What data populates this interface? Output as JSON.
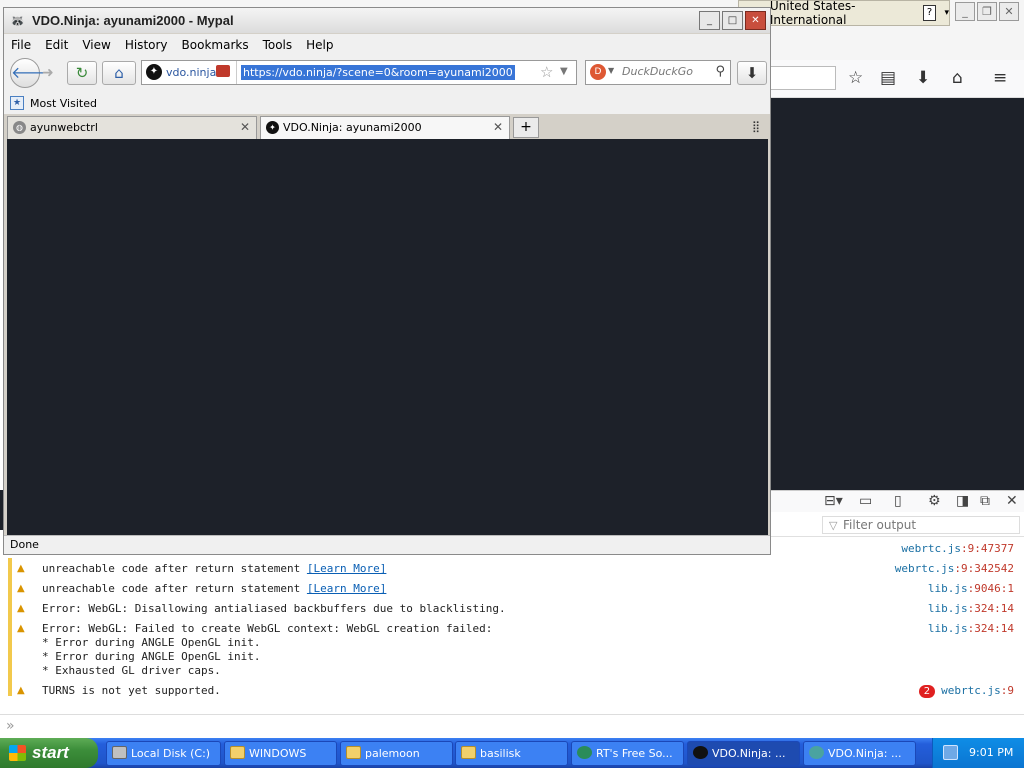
{
  "background_browser": {
    "language_bar": {
      "language": "United States-International",
      "help_label": "?"
    }
  },
  "devtools": {
    "filter_placeholder": "Filter output",
    "messages": [
      {
        "type": "warning",
        "text": "",
        "link": "",
        "source": "webrtc.js",
        "location": ":9:47377"
      },
      {
        "type": "warning",
        "text": "unreachable code after return statement ",
        "link": "[Learn More]",
        "source": "webrtc.js",
        "location": ":9:342542"
      },
      {
        "type": "warning",
        "text": "unreachable code after return statement ",
        "link": "[Learn More]",
        "source": "lib.js",
        "location": ":9046:1"
      },
      {
        "type": "warning",
        "text": "Error: WebGL: Disallowing antialiased backbuffers due to blacklisting.",
        "link": "",
        "source": "lib.js",
        "location": ":324:14"
      },
      {
        "type": "warning",
        "text": "Error: WebGL: Failed to create WebGL context: WebGL creation failed:\n* Error during ANGLE OpenGL init.\n* Error during ANGLE OpenGL init.\n* Exhausted GL driver caps.",
        "link": "",
        "source": "lib.js",
        "location": ":324:14"
      },
      {
        "type": "warning",
        "text": "TURNS is not yet supported.",
        "link": "",
        "source": "webrtc.js",
        "location": ":9",
        "repeat": "2"
      }
    ]
  },
  "window": {
    "title": "VDO.Ninja: ayunami2000 - Mypal",
    "menu": [
      "File",
      "Edit",
      "View",
      "History",
      "Bookmarks",
      "Tools",
      "Help"
    ],
    "url_identity": "vdo.ninja",
    "url": "https://vdo.ninja/?scene=0&room=ayunami2000",
    "search_placeholder": "DuckDuckGo",
    "bookmarks": {
      "most_visited": "Most Visited"
    },
    "tabs": [
      {
        "label": "ayunwebctrl",
        "active": false
      },
      {
        "label": "VDO.Ninja: ayunami2000",
        "active": true
      }
    ],
    "status": "Done"
  },
  "taskbar": {
    "start": "start",
    "items": [
      {
        "label": "Local Disk (C:)",
        "icon": "drive"
      },
      {
        "label": "WINDOWS",
        "icon": "folder"
      },
      {
        "label": "palemoon",
        "icon": "folder"
      },
      {
        "label": "basilisk",
        "icon": "folder"
      },
      {
        "label": "RT's Free So...",
        "icon": "rt"
      },
      {
        "label": "VDO.Ninja: ...",
        "icon": "app",
        "active": true
      },
      {
        "label": "VDO.Ninja: ...",
        "icon": "app2"
      }
    ],
    "clock": "9:01 PM"
  },
  "colors": {
    "content_bg": "#1d2129",
    "warning": "#d99400",
    "taskbar": "#245edb",
    "start": "#3c8e3a"
  }
}
